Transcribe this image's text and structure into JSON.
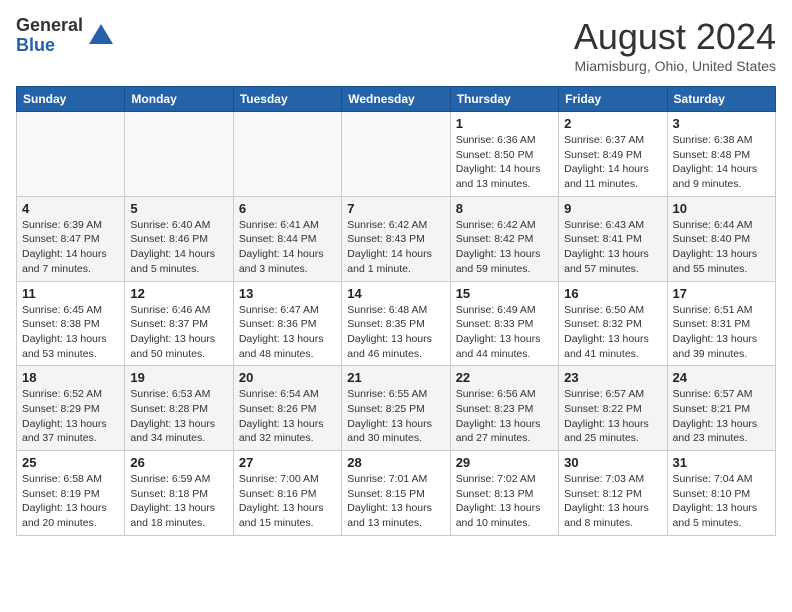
{
  "header": {
    "logo_general": "General",
    "logo_blue": "Blue",
    "month_title": "August 2024",
    "location": "Miamisburg, Ohio, United States"
  },
  "weekdays": [
    "Sunday",
    "Monday",
    "Tuesday",
    "Wednesday",
    "Thursday",
    "Friday",
    "Saturday"
  ],
  "weeks": [
    [
      {
        "day": "",
        "info": ""
      },
      {
        "day": "",
        "info": ""
      },
      {
        "day": "",
        "info": ""
      },
      {
        "day": "",
        "info": ""
      },
      {
        "day": "1",
        "info": "Sunrise: 6:36 AM\nSunset: 8:50 PM\nDaylight: 14 hours and 13 minutes."
      },
      {
        "day": "2",
        "info": "Sunrise: 6:37 AM\nSunset: 8:49 PM\nDaylight: 14 hours and 11 minutes."
      },
      {
        "day": "3",
        "info": "Sunrise: 6:38 AM\nSunset: 8:48 PM\nDaylight: 14 hours and 9 minutes."
      }
    ],
    [
      {
        "day": "4",
        "info": "Sunrise: 6:39 AM\nSunset: 8:47 PM\nDaylight: 14 hours and 7 minutes."
      },
      {
        "day": "5",
        "info": "Sunrise: 6:40 AM\nSunset: 8:46 PM\nDaylight: 14 hours and 5 minutes."
      },
      {
        "day": "6",
        "info": "Sunrise: 6:41 AM\nSunset: 8:44 PM\nDaylight: 14 hours and 3 minutes."
      },
      {
        "day": "7",
        "info": "Sunrise: 6:42 AM\nSunset: 8:43 PM\nDaylight: 14 hours and 1 minute."
      },
      {
        "day": "8",
        "info": "Sunrise: 6:42 AM\nSunset: 8:42 PM\nDaylight: 13 hours and 59 minutes."
      },
      {
        "day": "9",
        "info": "Sunrise: 6:43 AM\nSunset: 8:41 PM\nDaylight: 13 hours and 57 minutes."
      },
      {
        "day": "10",
        "info": "Sunrise: 6:44 AM\nSunset: 8:40 PM\nDaylight: 13 hours and 55 minutes."
      }
    ],
    [
      {
        "day": "11",
        "info": "Sunrise: 6:45 AM\nSunset: 8:38 PM\nDaylight: 13 hours and 53 minutes."
      },
      {
        "day": "12",
        "info": "Sunrise: 6:46 AM\nSunset: 8:37 PM\nDaylight: 13 hours and 50 minutes."
      },
      {
        "day": "13",
        "info": "Sunrise: 6:47 AM\nSunset: 8:36 PM\nDaylight: 13 hours and 48 minutes."
      },
      {
        "day": "14",
        "info": "Sunrise: 6:48 AM\nSunset: 8:35 PM\nDaylight: 13 hours and 46 minutes."
      },
      {
        "day": "15",
        "info": "Sunrise: 6:49 AM\nSunset: 8:33 PM\nDaylight: 13 hours and 44 minutes."
      },
      {
        "day": "16",
        "info": "Sunrise: 6:50 AM\nSunset: 8:32 PM\nDaylight: 13 hours and 41 minutes."
      },
      {
        "day": "17",
        "info": "Sunrise: 6:51 AM\nSunset: 8:31 PM\nDaylight: 13 hours and 39 minutes."
      }
    ],
    [
      {
        "day": "18",
        "info": "Sunrise: 6:52 AM\nSunset: 8:29 PM\nDaylight: 13 hours and 37 minutes."
      },
      {
        "day": "19",
        "info": "Sunrise: 6:53 AM\nSunset: 8:28 PM\nDaylight: 13 hours and 34 minutes."
      },
      {
        "day": "20",
        "info": "Sunrise: 6:54 AM\nSunset: 8:26 PM\nDaylight: 13 hours and 32 minutes."
      },
      {
        "day": "21",
        "info": "Sunrise: 6:55 AM\nSunset: 8:25 PM\nDaylight: 13 hours and 30 minutes."
      },
      {
        "day": "22",
        "info": "Sunrise: 6:56 AM\nSunset: 8:23 PM\nDaylight: 13 hours and 27 minutes."
      },
      {
        "day": "23",
        "info": "Sunrise: 6:57 AM\nSunset: 8:22 PM\nDaylight: 13 hours and 25 minutes."
      },
      {
        "day": "24",
        "info": "Sunrise: 6:57 AM\nSunset: 8:21 PM\nDaylight: 13 hours and 23 minutes."
      }
    ],
    [
      {
        "day": "25",
        "info": "Sunrise: 6:58 AM\nSunset: 8:19 PM\nDaylight: 13 hours and 20 minutes."
      },
      {
        "day": "26",
        "info": "Sunrise: 6:59 AM\nSunset: 8:18 PM\nDaylight: 13 hours and 18 minutes."
      },
      {
        "day": "27",
        "info": "Sunrise: 7:00 AM\nSunset: 8:16 PM\nDaylight: 13 hours and 15 minutes."
      },
      {
        "day": "28",
        "info": "Sunrise: 7:01 AM\nSunset: 8:15 PM\nDaylight: 13 hours and 13 minutes."
      },
      {
        "day": "29",
        "info": "Sunrise: 7:02 AM\nSunset: 8:13 PM\nDaylight: 13 hours and 10 minutes."
      },
      {
        "day": "30",
        "info": "Sunrise: 7:03 AM\nSunset: 8:12 PM\nDaylight: 13 hours and 8 minutes."
      },
      {
        "day": "31",
        "info": "Sunrise: 7:04 AM\nSunset: 8:10 PM\nDaylight: 13 hours and 5 minutes."
      }
    ]
  ]
}
